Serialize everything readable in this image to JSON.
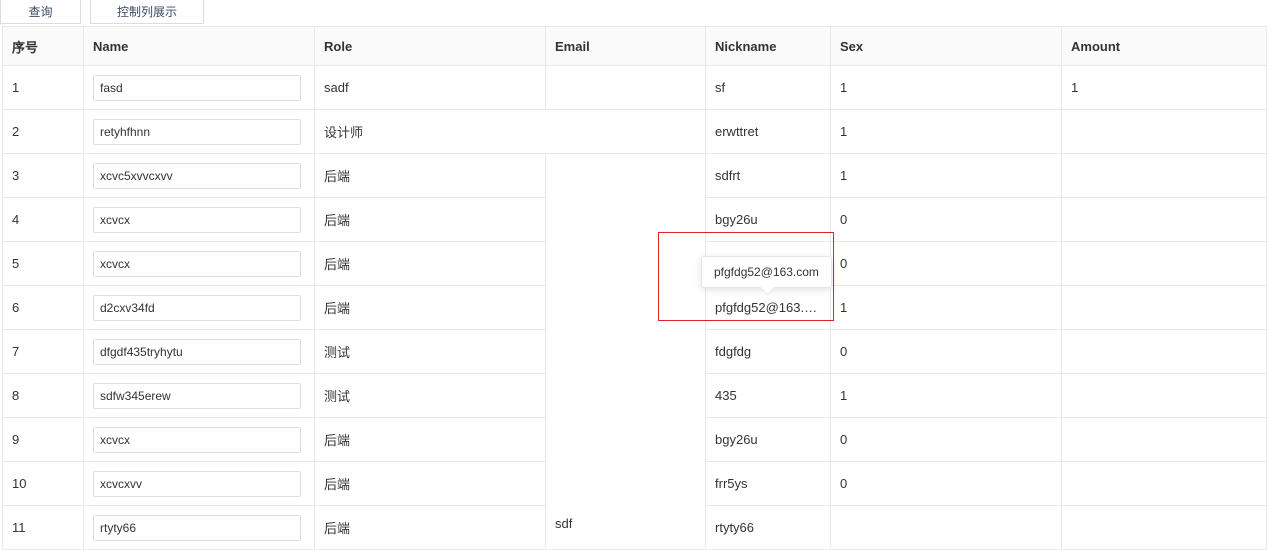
{
  "toolbar": {
    "query_label": "查询",
    "columns_label": "控制列展示"
  },
  "table": {
    "headers": [
      "序号",
      "Name",
      "Role",
      "Email",
      "Nickname",
      "Sex",
      "Amount"
    ],
    "rows": [
      {
        "index": "1",
        "name": "fasd",
        "role": "sadf",
        "email": "",
        "nickname": "sf",
        "sex": "1",
        "amount": "1"
      },
      {
        "index": "2",
        "name": "retyhfhnn",
        "role": "设计师",
        "email": "",
        "nickname": "erwttret",
        "sex": "1",
        "amount": ""
      },
      {
        "index": "3",
        "name": "xcvc5xvvcxvv",
        "role": "后端",
        "email": "",
        "nickname": "sdfrt",
        "sex": "1",
        "amount": ""
      },
      {
        "index": "4",
        "name": "xcvcx",
        "role": "后端",
        "email": "",
        "nickname": "bgy26u",
        "sex": "0",
        "amount": ""
      },
      {
        "index": "5",
        "name": "xcvcx",
        "role": "后端",
        "email": "",
        "nickname": "",
        "sex": "0",
        "amount": ""
      },
      {
        "index": "6",
        "name": "d2cxv34fd",
        "role": "后端",
        "email": "",
        "nickname": "pfgfdg52@163.com",
        "sex": "1",
        "amount": ""
      },
      {
        "index": "7",
        "name": "dfgdf435tryhytu",
        "role": "测试",
        "email": "",
        "nickname": "fdgfdg",
        "sex": "0",
        "amount": ""
      },
      {
        "index": "8",
        "name": "sdfw345erew",
        "role": "测试",
        "email": "",
        "nickname": "435",
        "sex": "1",
        "amount": ""
      },
      {
        "index": "9",
        "name": "xcvcx",
        "role": "后端",
        "email": "",
        "nickname": "bgy26u",
        "sex": "0",
        "amount": ""
      },
      {
        "index": "10",
        "name": "xcvcxvv",
        "role": "后端",
        "email": "",
        "nickname": "frr5ys",
        "sex": "0",
        "amount": ""
      },
      {
        "index": "11",
        "name": "rtyty66",
        "role": "后端",
        "email": "",
        "nickname": "rtyty66",
        "sex": "",
        "amount": ""
      }
    ],
    "merged_email_value": "sdf"
  },
  "tooltip": {
    "text": "pfgfdg52@163.com"
  },
  "colors": {
    "highlight": "#e0262b",
    "border": "#e8e8e8",
    "header_bg": "#fafafa"
  }
}
